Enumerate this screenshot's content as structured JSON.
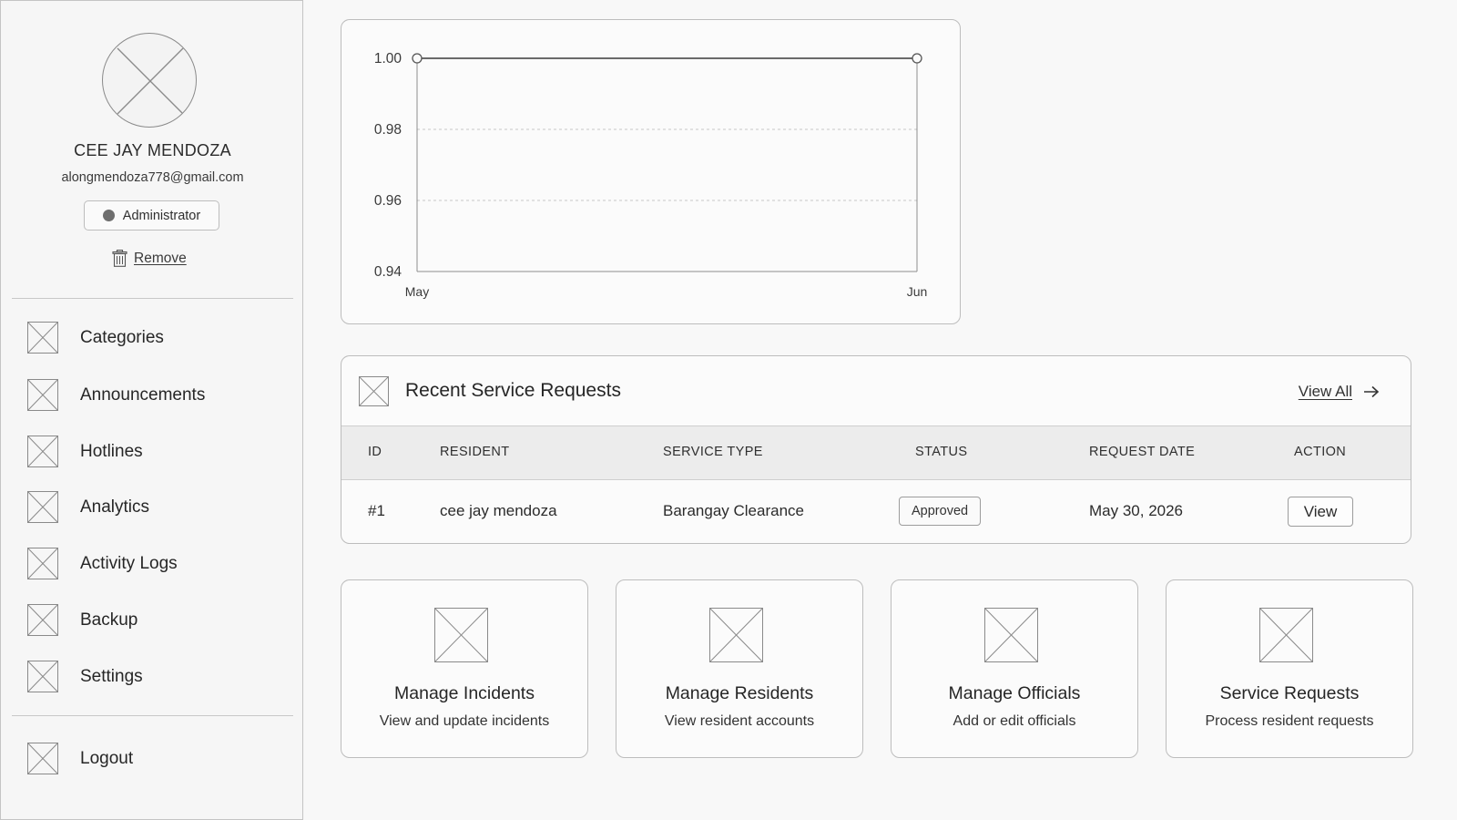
{
  "profile": {
    "name": "CEE JAY MENDOZA",
    "email": "alongmendoza778@gmail.com",
    "role": "Administrator",
    "remove_label": "Remove"
  },
  "sidebar": {
    "items": [
      {
        "label": "Categories"
      },
      {
        "label": "Announcements"
      },
      {
        "label": "Hotlines"
      },
      {
        "label": "Analytics"
      },
      {
        "label": "Activity Logs"
      },
      {
        "label": "Backup"
      },
      {
        "label": "Settings"
      }
    ],
    "logout_label": "Logout"
  },
  "chart_data": {
    "type": "line",
    "x": [
      "May",
      "Jun"
    ],
    "series": [
      {
        "values": [
          1.0,
          1.0
        ]
      }
    ],
    "y_ticks": [
      "1.00",
      "0.98",
      "0.96",
      "0.94"
    ],
    "ylim": [
      0.94,
      1.0
    ],
    "grid": true,
    "title": "",
    "xlabel": "",
    "ylabel": ""
  },
  "requests": {
    "title": "Recent Service Requests",
    "view_all_label": "View All",
    "columns": [
      "ID",
      "RESIDENT",
      "SERVICE TYPE",
      "STATUS",
      "REQUEST DATE",
      "ACTION"
    ],
    "rows": [
      {
        "id": "#1",
        "resident": "cee jay mendoza",
        "service_type": "Barangay Clearance",
        "status": "Approved",
        "request_date": "May 30, 2026",
        "action": "View"
      }
    ]
  },
  "actions": [
    {
      "title": "Manage Incidents",
      "desc": "View and update incidents"
    },
    {
      "title": "Manage Residents",
      "desc": "View resident accounts"
    },
    {
      "title": "Manage Officials",
      "desc": "Add or edit officials"
    },
    {
      "title": "Service Requests",
      "desc": "Process resident requests"
    }
  ],
  "colors": {
    "border": "#bdbdbd",
    "line": "#555555",
    "grid": "#c7c7c7",
    "header_bg": "#ececec"
  }
}
